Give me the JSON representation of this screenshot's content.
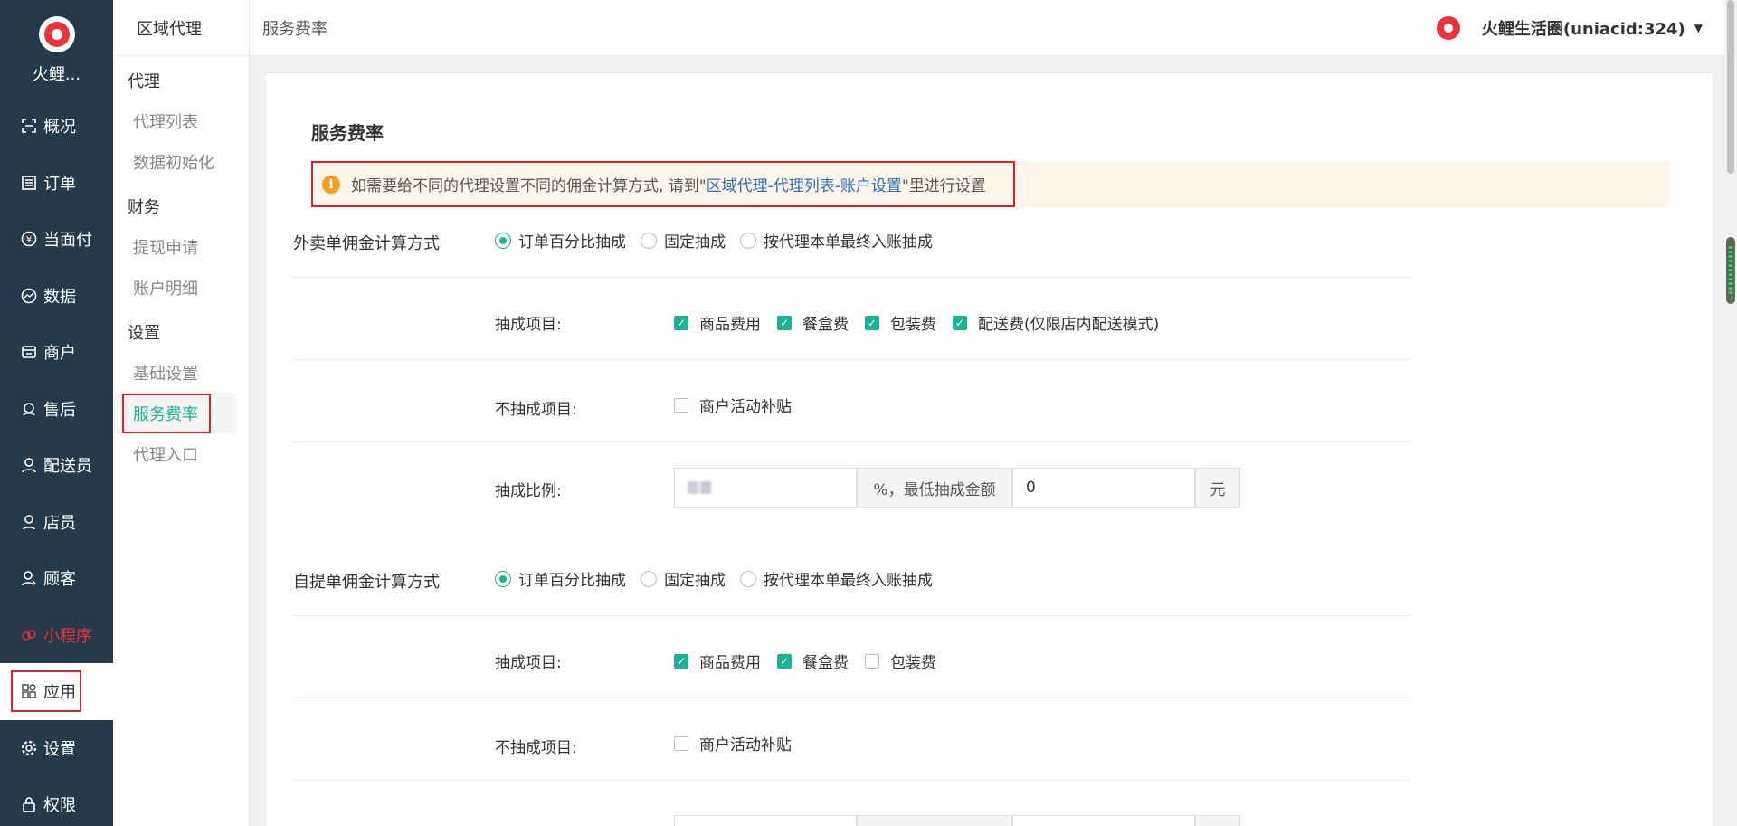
{
  "brand": {
    "name": "火鲤..."
  },
  "nav": [
    {
      "label": "概况",
      "icon": "overview-icon"
    },
    {
      "label": "订单",
      "icon": "order-icon"
    },
    {
      "label": "当面付",
      "icon": "yen-icon"
    },
    {
      "label": "数据",
      "icon": "chart-icon"
    },
    {
      "label": "商户",
      "icon": "store-icon"
    },
    {
      "label": "售后",
      "icon": "headset-icon"
    },
    {
      "label": "配送员",
      "icon": "courier-icon"
    },
    {
      "label": "店员",
      "icon": "clerk-icon"
    },
    {
      "label": "顾客",
      "icon": "customer-icon"
    },
    {
      "label": "小程序",
      "icon": "miniapp-icon"
    },
    {
      "label": "应用",
      "icon": "apps-icon"
    },
    {
      "label": "设置",
      "icon": "gear-icon"
    },
    {
      "label": "权限",
      "icon": "lock-icon"
    }
  ],
  "submenu": {
    "title": "区域代理",
    "groups": [
      {
        "label": "代理",
        "items": [
          "代理列表",
          "数据初始化"
        ]
      },
      {
        "label": "财务",
        "items": [
          "提现申请",
          "账户明细"
        ]
      },
      {
        "label": "设置",
        "items": [
          "基础设置",
          "服务费率",
          "代理入口"
        ]
      }
    ]
  },
  "header": {
    "title": "服务费率",
    "account": "火鲤生活圈(uniacid:324)"
  },
  "page": {
    "title": "服务费率",
    "notice_prefix": "如需要给不同的代理设置不同的佣金计算方式, 请到\"",
    "notice_link": "区域代理-代理列表-账户设置",
    "notice_suffix": "\"里进行设置"
  },
  "takeout": {
    "label": "外卖单佣金计算方式",
    "radios": [
      "订单百分比抽成",
      "固定抽成",
      "按代理本单最终入账抽成"
    ],
    "items_label": "抽成项目:",
    "items": [
      "商品费用",
      "餐盒费",
      "包装费",
      "配送费(仅限店内配送模式)"
    ],
    "exclude_label": "不抽成项目:",
    "exclude_items": [
      "商户活动补贴"
    ],
    "ratio_label": "抽成比例:",
    "ratio_addon": "%，最低抽成金额",
    "min_value": "0",
    "unit": "元"
  },
  "pickup": {
    "label": "自提单佣金计算方式",
    "radios": [
      "订单百分比抽成",
      "固定抽成",
      "按代理本单最终入账抽成"
    ],
    "items_label": "抽成项目:",
    "items": [
      "商品费用",
      "餐盒费",
      "包装费"
    ],
    "exclude_label": "不抽成项目:",
    "exclude_items": [
      "商户活动补贴"
    ]
  }
}
